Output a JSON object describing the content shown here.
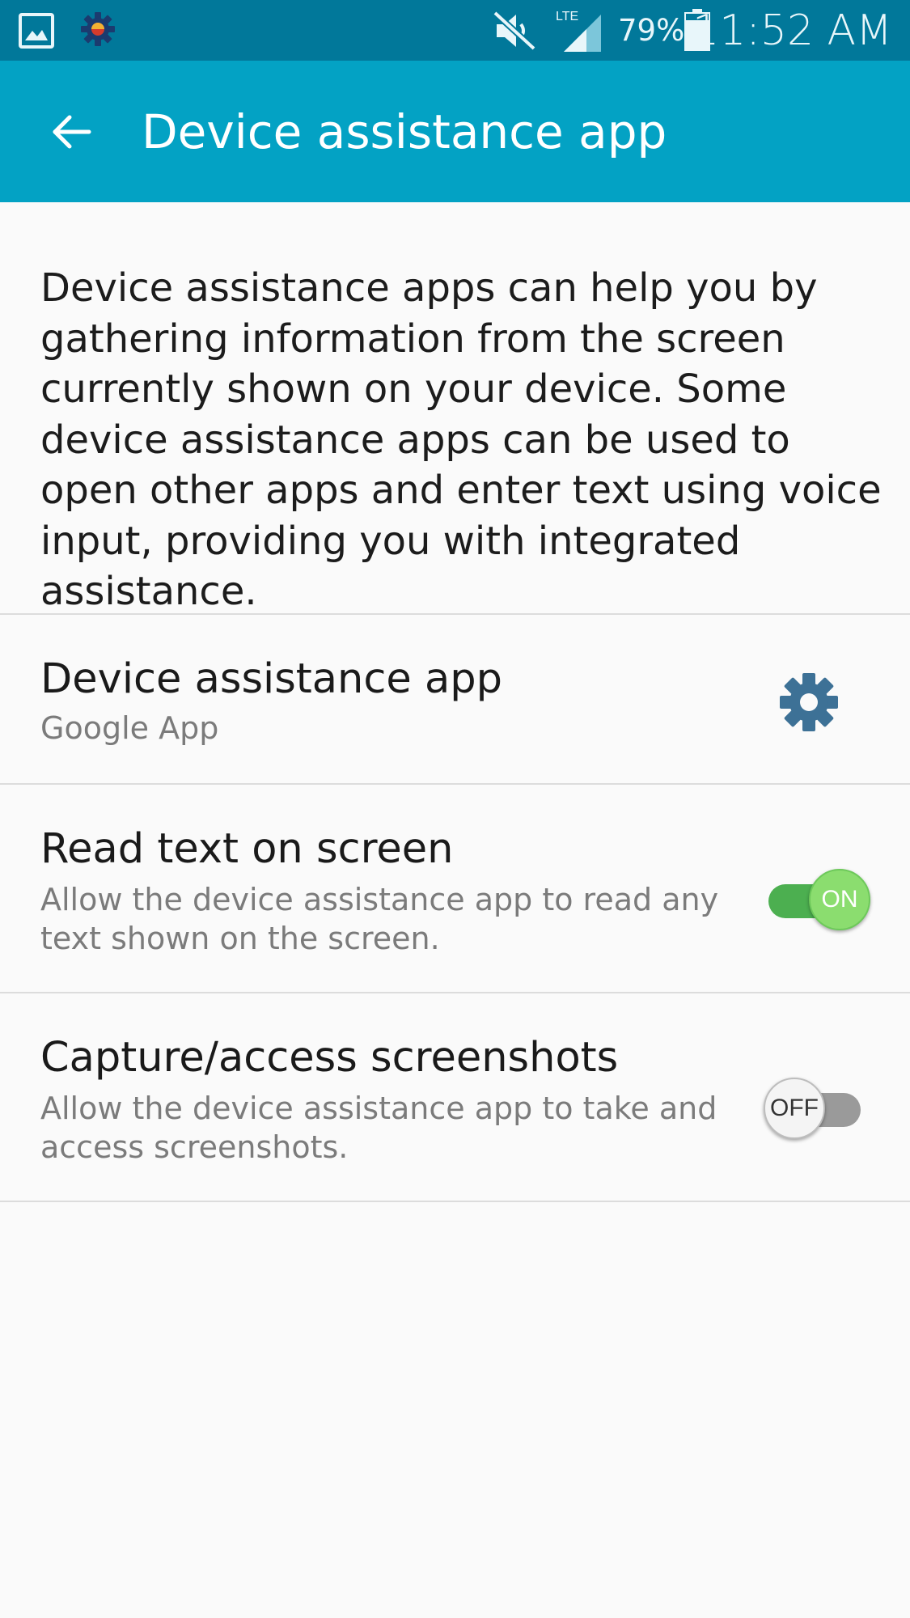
{
  "status_bar": {
    "battery_percent": "79%",
    "time": "11:52 AM",
    "network_label": "LTE",
    "icons": [
      "gallery-icon",
      "settings-notification-icon",
      "mute-icon",
      "signal-icon",
      "battery-icon"
    ]
  },
  "app_bar": {
    "title": "Device assistance app",
    "back_icon": "arrow-back-icon",
    "color": "#03a2c4"
  },
  "description": "Device assistance apps can help you by gathering information from the screen currently shown on your device. Some device assistance apps can be used to open other apps and enter text using voice input, providing you with integrated assistance.",
  "settings": [
    {
      "title": "Device assistance app",
      "subtitle": "Google App",
      "control": "gear-icon"
    },
    {
      "title": "Read text on screen",
      "subtitle": "Allow the device assistance app to read any text shown on the screen.",
      "control": "toggle",
      "state": "ON"
    },
    {
      "title": "Capture/access screenshots",
      "subtitle": "Allow the device assistance app to take and access screenshots.",
      "control": "toggle",
      "state": "OFF"
    }
  ],
  "colors": {
    "status_bar": "#01789a",
    "toggle_on": "#4caf50",
    "gear": "#3d7196"
  }
}
